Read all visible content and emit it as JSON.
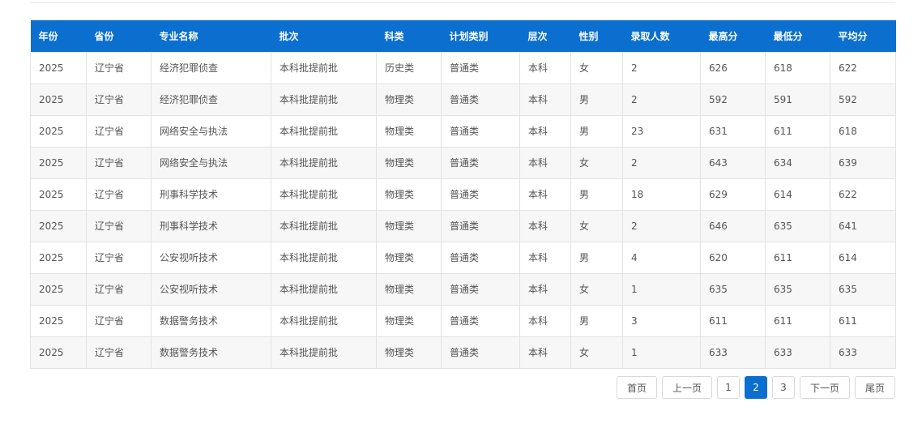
{
  "table": {
    "headers": [
      "年份",
      "省份",
      "专业名称",
      "批次",
      "科类",
      "计划类别",
      "层次",
      "性别",
      "录取人数",
      "最高分",
      "最低分",
      "平均分"
    ],
    "rows": [
      [
        "2025",
        "辽宁省",
        "经济犯罪侦查",
        "本科批提前批",
        "历史类",
        "普通类",
        "本科",
        "女",
        "2",
        "626",
        "618",
        "622"
      ],
      [
        "2025",
        "辽宁省",
        "经济犯罪侦查",
        "本科批提前批",
        "物理类",
        "普通类",
        "本科",
        "男",
        "2",
        "592",
        "591",
        "592"
      ],
      [
        "2025",
        "辽宁省",
        "网络安全与执法",
        "本科批提前批",
        "物理类",
        "普通类",
        "本科",
        "男",
        "23",
        "631",
        "611",
        "618"
      ],
      [
        "2025",
        "辽宁省",
        "网络安全与执法",
        "本科批提前批",
        "物理类",
        "普通类",
        "本科",
        "女",
        "2",
        "643",
        "634",
        "639"
      ],
      [
        "2025",
        "辽宁省",
        "刑事科学技术",
        "本科批提前批",
        "物理类",
        "普通类",
        "本科",
        "男",
        "18",
        "629",
        "614",
        "622"
      ],
      [
        "2025",
        "辽宁省",
        "刑事科学技术",
        "本科批提前批",
        "物理类",
        "普通类",
        "本科",
        "女",
        "2",
        "646",
        "635",
        "641"
      ],
      [
        "2025",
        "辽宁省",
        "公安视听技术",
        "本科批提前批",
        "物理类",
        "普通类",
        "本科",
        "男",
        "4",
        "620",
        "611",
        "614"
      ],
      [
        "2025",
        "辽宁省",
        "公安视听技术",
        "本科批提前批",
        "物理类",
        "普通类",
        "本科",
        "女",
        "1",
        "635",
        "635",
        "635"
      ],
      [
        "2025",
        "辽宁省",
        "数据警务技术",
        "本科批提前批",
        "物理类",
        "普通类",
        "本科",
        "男",
        "3",
        "611",
        "611",
        "611"
      ],
      [
        "2025",
        "辽宁省",
        "数据警务技术",
        "本科批提前批",
        "物理类",
        "普通类",
        "本科",
        "女",
        "1",
        "633",
        "633",
        "633"
      ]
    ]
  },
  "pagination": {
    "first": "首页",
    "prev": "上一页",
    "pages": [
      "1",
      "2",
      "3"
    ],
    "current": "2",
    "next": "下一页",
    "last": "尾页"
  },
  "colors": {
    "header_bg": "#0a6fcf",
    "active_page": "#0a6fcf"
  }
}
